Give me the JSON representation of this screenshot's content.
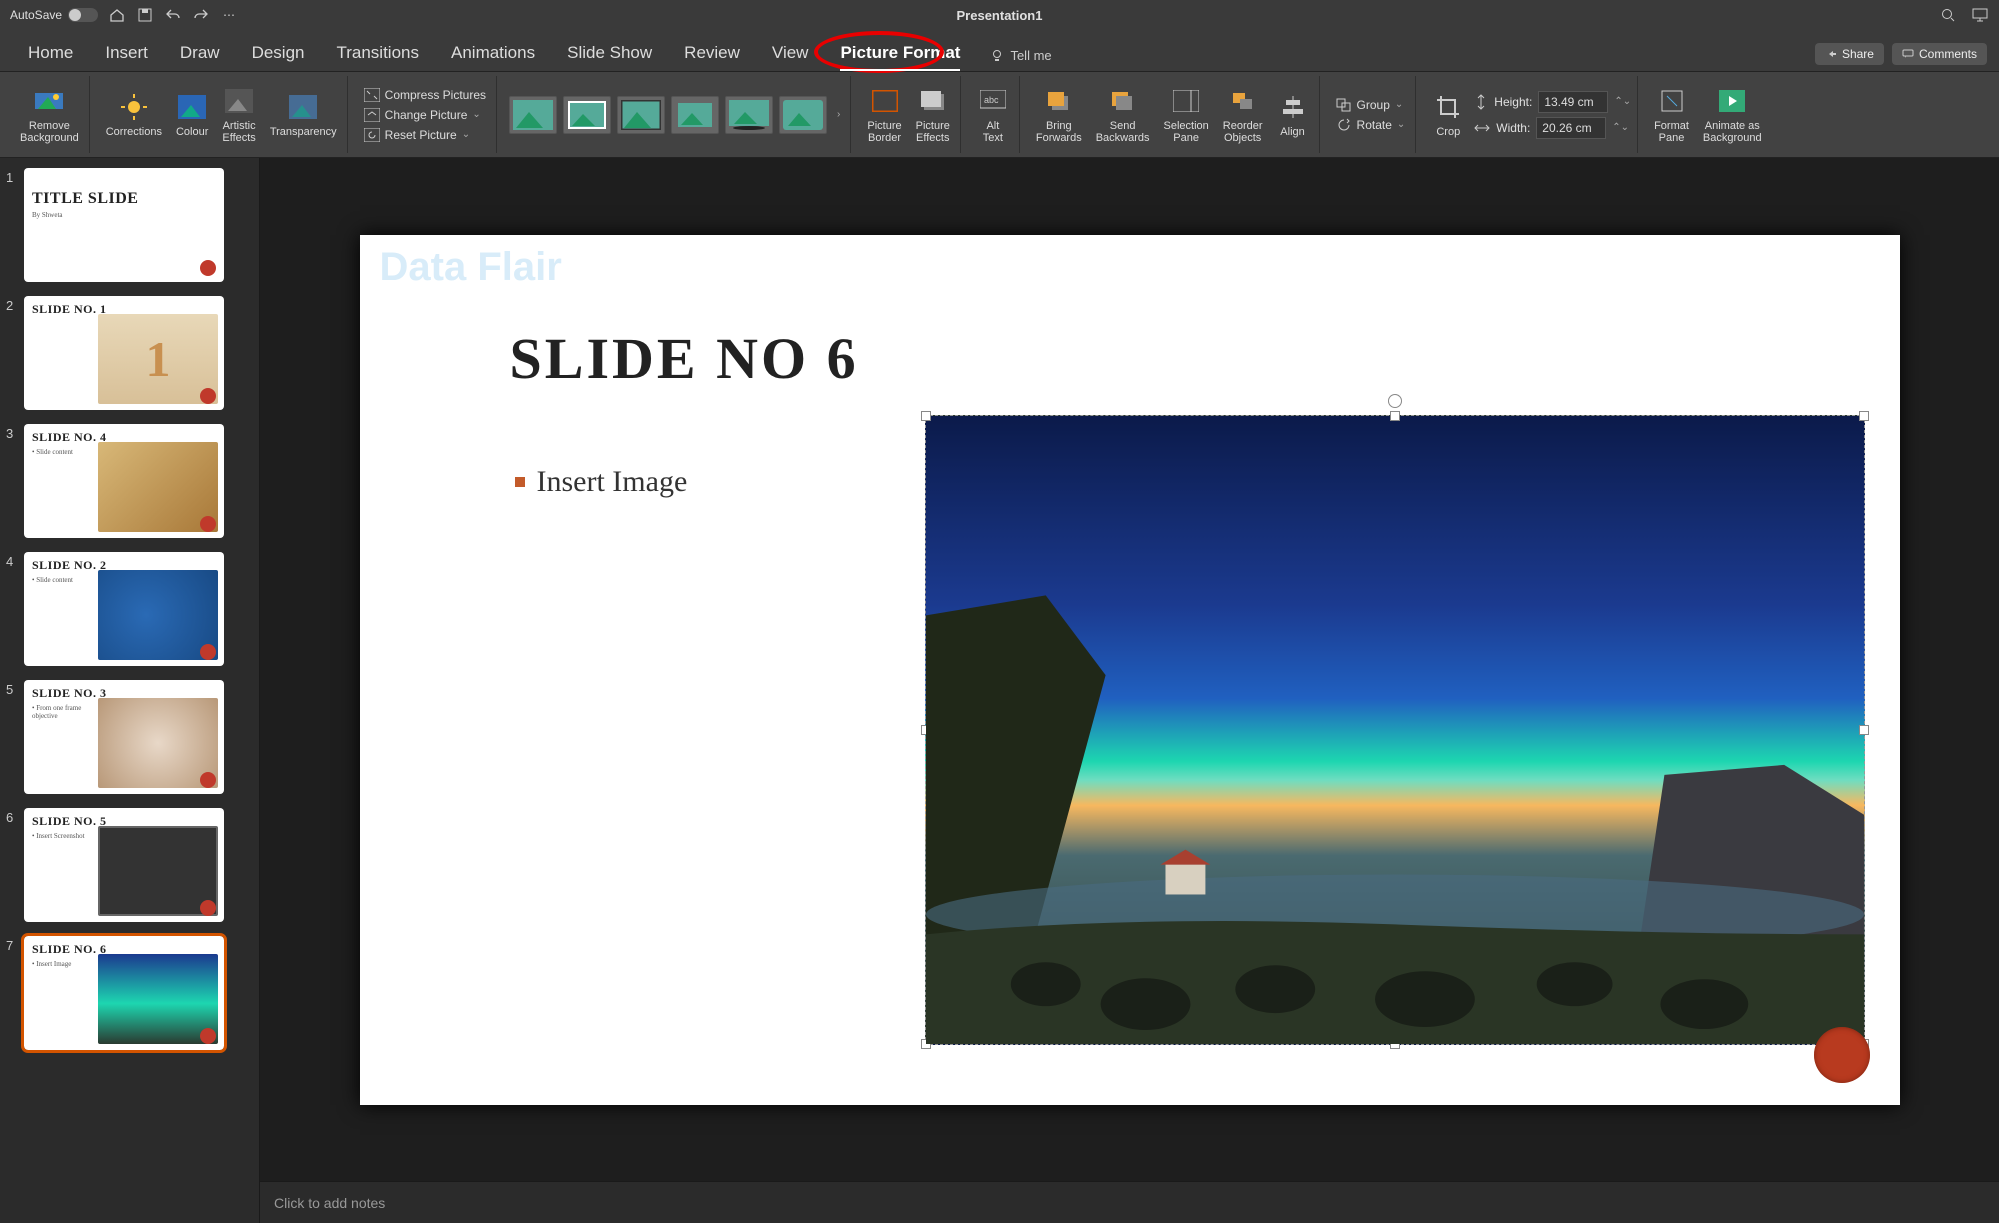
{
  "titlebar": {
    "autosave_label": "AutoSave",
    "autosave_state": "OFF",
    "title": "Presentation1"
  },
  "tabs": {
    "items": [
      "Home",
      "Insert",
      "Draw",
      "Design",
      "Transitions",
      "Animations",
      "Slide Show",
      "Review",
      "View",
      "Picture Format"
    ],
    "active_index": 9,
    "tell_me": "Tell me",
    "share": "Share",
    "comments": "Comments"
  },
  "ribbon": {
    "remove_bg": "Remove\nBackground",
    "corrections": "Corrections",
    "colour": "Colour",
    "artistic": "Artistic\nEffects",
    "transparency": "Transparency",
    "compress": "Compress Pictures",
    "change_pic": "Change Picture",
    "reset_pic": "Reset Picture",
    "pic_border": "Picture\nBorder",
    "pic_effects": "Picture\nEffects",
    "alt_text": "Alt\nText",
    "bring_fwd": "Bring\nForwards",
    "send_back": "Send\nBackwards",
    "sel_pane": "Selection\nPane",
    "reorder": "Reorder\nObjects",
    "align": "Align",
    "group": "Group",
    "rotate": "Rotate",
    "crop": "Crop",
    "height_label": "Height:",
    "height_val": "13.49 cm",
    "width_label": "Width:",
    "width_val": "20.26 cm",
    "format_pane": "Format\nPane",
    "animate_bg": "Animate as\nBackground"
  },
  "thumbs": [
    {
      "title": "TITLE SLIDE",
      "sub": "By Shweta"
    },
    {
      "title": "SLIDE NO. 1",
      "sub": ""
    },
    {
      "title": "SLIDE NO. 4",
      "sub": "• Slide content"
    },
    {
      "title": "SLIDE NO. 2",
      "sub": "• Slide content"
    },
    {
      "title": "SLIDE NO. 3",
      "sub": "• From one frame\n  objective"
    },
    {
      "title": "SLIDE NO. 5",
      "sub": "• Insert Screenshot"
    },
    {
      "title": "SLIDE NO. 6",
      "sub": "• Insert Image"
    }
  ],
  "slide": {
    "title": "SLIDE NO 6",
    "bullet": "Insert Image"
  },
  "notes_placeholder": "Click to add notes",
  "watermarks": [
    "Data Flair",
    "Data Flair"
  ]
}
